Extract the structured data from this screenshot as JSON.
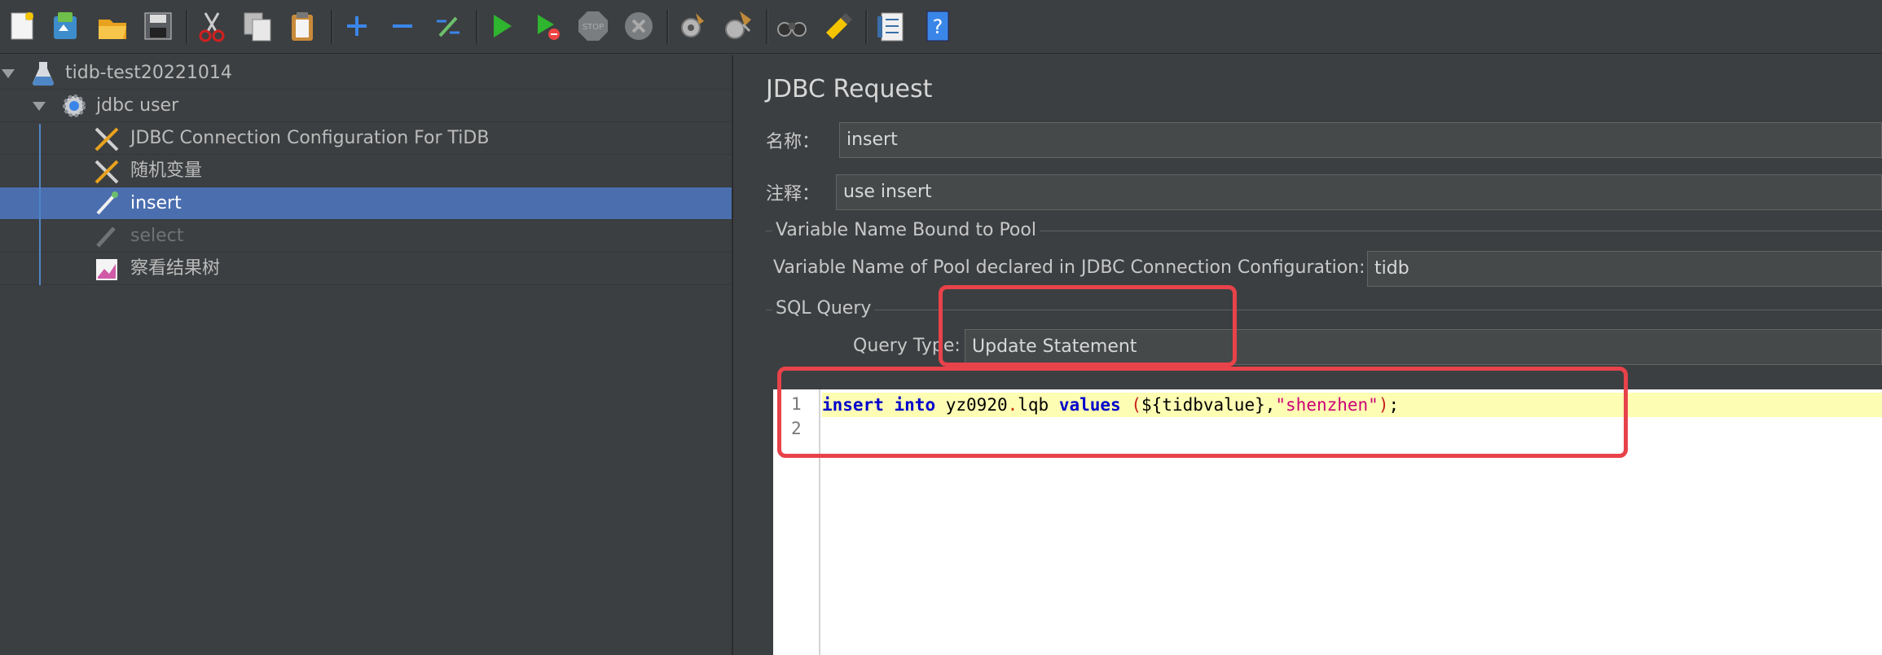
{
  "toolbar": {
    "buttons": [
      "new-icon",
      "templates-icon",
      "open-icon",
      "save-icon",
      "cut-icon",
      "copy-icon",
      "paste-icon",
      "expand-icon",
      "collapse-icon",
      "toggle-icon",
      "start-icon",
      "start-no-pause-icon",
      "stop-icon",
      "shutdown-icon",
      "clear-icon",
      "clear-all-icon",
      "search-icon",
      "reset-search-icon",
      "function-helper-icon",
      "help-icon"
    ]
  },
  "tree": {
    "items": [
      {
        "label": "tidb-test20221014",
        "icon": "test-plan-icon",
        "state": "normal"
      },
      {
        "label": "jdbc user",
        "icon": "thread-group-gear-icon",
        "state": "normal"
      },
      {
        "label": "JDBC Connection Configuration For TiDB",
        "icon": "config-tools-icon",
        "state": "normal"
      },
      {
        "label": "随机变量",
        "icon": "config-tools-icon",
        "state": "normal"
      },
      {
        "label": "insert",
        "icon": "sampler-pipette-icon",
        "state": "selected"
      },
      {
        "label": "select",
        "icon": "sampler-pipette-icon",
        "state": "disabled"
      },
      {
        "label": "察看结果树",
        "icon": "listener-graph-icon",
        "state": "normal"
      }
    ]
  },
  "panel": {
    "title": "JDBC Request",
    "name_label": "名称：",
    "name_value": "insert",
    "comments_label": "注释：",
    "comments_value": "use insert",
    "pool_group_title": "Variable Name Bound to Pool",
    "pool_label": "Variable Name of Pool declared in JDBC Connection Configuration:",
    "pool_value": "tidb",
    "sql_group_title": "SQL Query",
    "query_type_label": "Query Type:",
    "query_type_value": "Update Statement",
    "editor": {
      "line_numbers": [
        "1",
        "2"
      ],
      "line1": {
        "kw1": "insert",
        "kw2": "into",
        "table_schema": "yz0920",
        "dot": ".",
        "table_name": "lqb ",
        "kw3": "values",
        "open_paren": "(",
        "var": "${tidbvalue},",
        "string": "\"shenzhen\"",
        "close_paren": ")",
        "semicolon": ";"
      }
    }
  },
  "colors": {
    "background": "#3c3f41",
    "selection": "#4b6eaf",
    "annotation_red": "#e8424a",
    "editor_highlight": "#fdfdb3"
  }
}
